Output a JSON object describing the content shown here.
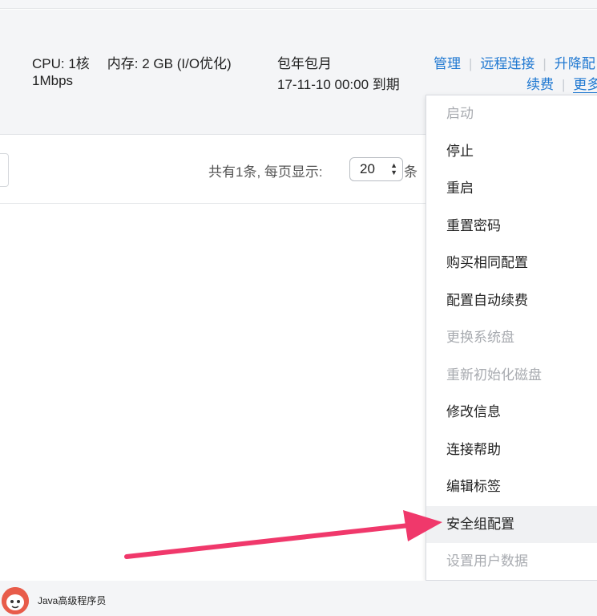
{
  "instance": {
    "cpu": "CPU:  1核",
    "memory": "内存: 2 GB (I/O优化)",
    "bandwidth": "1Mbps",
    "billing_type": "包年包月",
    "expire": "17-11-10 00:00 到期",
    "ops": {
      "manage": "管理",
      "remote": "远程连接",
      "upgrade": "升降配",
      "renew": "续费",
      "more": "更多"
    }
  },
  "pager": {
    "total_text": "共有1条,   每页显示:",
    "page_size": "20",
    "unit": "条"
  },
  "menu": {
    "items": [
      {
        "label": "启动",
        "disabled": true
      },
      {
        "label": "停止",
        "disabled": false
      },
      {
        "label": "重启",
        "disabled": false
      },
      {
        "label": "重置密码",
        "disabled": false
      },
      {
        "label": "购买相同配置",
        "disabled": false
      },
      {
        "label": "配置自动续费",
        "disabled": false
      },
      {
        "label": "更换系统盘",
        "disabled": true
      },
      {
        "label": "重新初始化磁盘",
        "disabled": true
      },
      {
        "label": "修改信息",
        "disabled": false
      },
      {
        "label": "连接帮助",
        "disabled": false
      },
      {
        "label": "编辑标签",
        "disabled": false
      },
      {
        "label": "安全组配置",
        "disabled": false,
        "active": true
      },
      {
        "label": "设置用户数据",
        "disabled": true
      }
    ]
  },
  "footer": {
    "account_name": "Java高级程序员"
  },
  "colors": {
    "link": "#1f78d1",
    "arrow": "#f0386b",
    "disabled": "#a8abb0"
  },
  "icons": {
    "page_size_spinner": "updown-arrows-icon",
    "avatar": "avatar-icon",
    "pointer": "pointer-arrow-icon"
  }
}
